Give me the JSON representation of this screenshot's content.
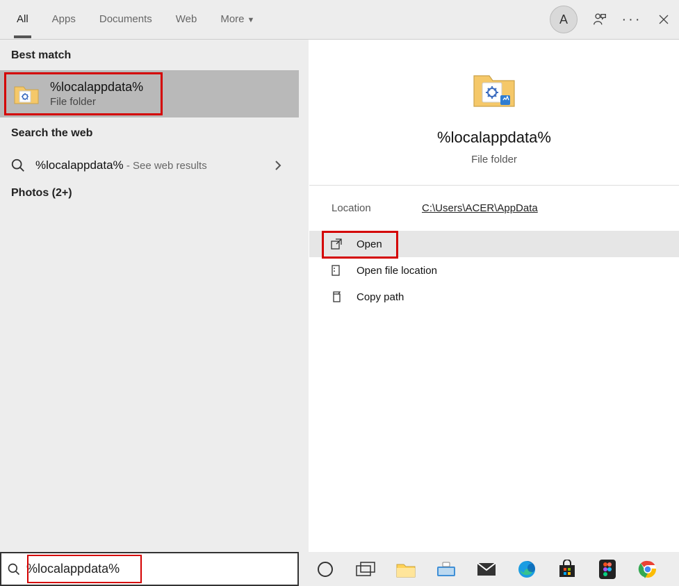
{
  "tabs": {
    "all": "All",
    "apps": "Apps",
    "documents": "Documents",
    "web": "Web",
    "more": "More"
  },
  "avatar_initial": "A",
  "sections": {
    "best_match": "Best match",
    "search_web": "Search the web",
    "photos": "Photos (2+)"
  },
  "best_match": {
    "title": "%localappdata%",
    "subtitle": "File folder"
  },
  "web_result": {
    "query": "%localappdata%",
    "suffix": " - See web results"
  },
  "preview": {
    "title": "%localappdata%",
    "subtitle": "File folder",
    "location_label": "Location",
    "location_value": "C:\\Users\\ACER\\AppData"
  },
  "actions": {
    "open": "Open",
    "open_loc": "Open file location",
    "copy_path": "Copy path"
  },
  "search_value": "%localappdata%"
}
